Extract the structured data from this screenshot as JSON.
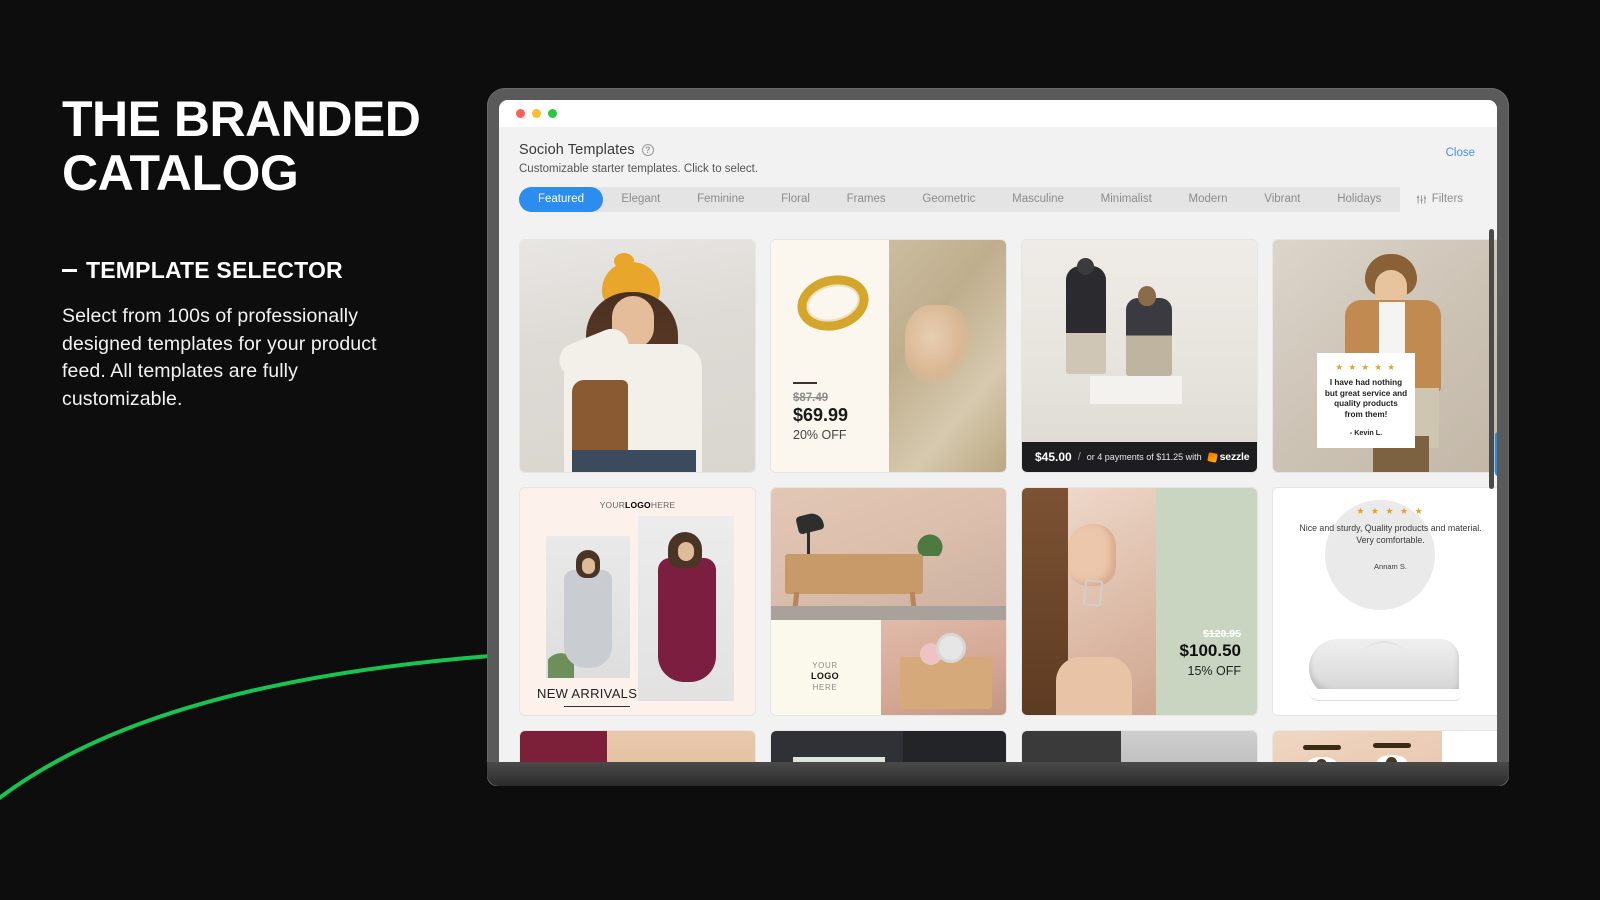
{
  "slide": {
    "headline": "THE BRANDED CATALOG",
    "kicker": "TEMPLATE SELECTOR",
    "body": "Select from 100s of professionally designed templates for your product feed. All templates are fully customizable.",
    "accent_color": "#18c451",
    "background_color": "#0d0d0d"
  },
  "window": {
    "traffic_lights": [
      "red",
      "amber",
      "green"
    ],
    "app_title": "Socioh Templates",
    "help_icon": "question-mark-icon",
    "subtitle": "Customizable starter templates. Click to select.",
    "close_label": "Close",
    "close_color": "#4a90e2"
  },
  "tabs": {
    "active": "Featured",
    "active_color": "#2d8cf0",
    "items": [
      {
        "label": "Featured",
        "active": true
      },
      {
        "label": "Elegant",
        "active": false
      },
      {
        "label": "Feminine",
        "active": false
      },
      {
        "label": "Floral",
        "active": false
      },
      {
        "label": "Frames",
        "active": false
      },
      {
        "label": "Geometric",
        "active": false
      },
      {
        "label": "Masculine",
        "active": false
      },
      {
        "label": "Minimalist",
        "active": false
      },
      {
        "label": "Modern",
        "active": false
      },
      {
        "label": "Vibrant",
        "active": false
      },
      {
        "label": "Holidays",
        "active": false
      }
    ],
    "filters_label": "Filters",
    "filters_icon": "sliders-icon"
  },
  "templates": {
    "row1": [
      {
        "name": "beanie-sweater-lifestyle",
        "overlay": null
      },
      {
        "name": "gold-ring-discount",
        "old_price": "$87.49",
        "price": "$69.99",
        "discount": "20% OFF"
      },
      {
        "name": "couple-sezzle-payment",
        "amount": "$45.00",
        "divider": "/",
        "terms": "or 4 payments of $11.25 with",
        "brand": "sezzle"
      },
      {
        "name": "man-blazer-testimonial",
        "stars": "★ ★ ★ ★ ★",
        "quote": "I have had nothing but great service and quality products from them!",
        "author": "- Kevin L."
      }
    ],
    "row2": [
      {
        "name": "new-arrivals-dresses",
        "logo_pre": "YOUR",
        "logo_mid": "LOGO",
        "logo_post": "HERE",
        "caption": "NEW ARRIVALS"
      },
      {
        "name": "furniture-logo-collage",
        "logo_l1": "YOUR",
        "logo_l2": "LOGO",
        "logo_l3": "HERE"
      },
      {
        "name": "earring-discount",
        "old_price": "$120.95",
        "price": "$100.50",
        "discount": "15% OFF"
      },
      {
        "name": "sneaker-review-bubble",
        "stars": "★ ★ ★ ★ ★",
        "quote": "Nice and sturdy, Quality products and material. Very comfortable.",
        "author": "Annam S."
      }
    ],
    "row3": [
      {
        "name": "maroon-portrait-partial"
      },
      {
        "name": "dark-geometric-partial"
      },
      {
        "name": "greyscale-split-partial"
      },
      {
        "name": "beauty-floral-partial"
      }
    ]
  },
  "widgets": {
    "scrollbar": "vertical-scrollbar",
    "help_badge_icon": "question-mark-icon",
    "announce_badge_icon": "megaphone-icon",
    "badge_color": "#1f8cf0"
  }
}
